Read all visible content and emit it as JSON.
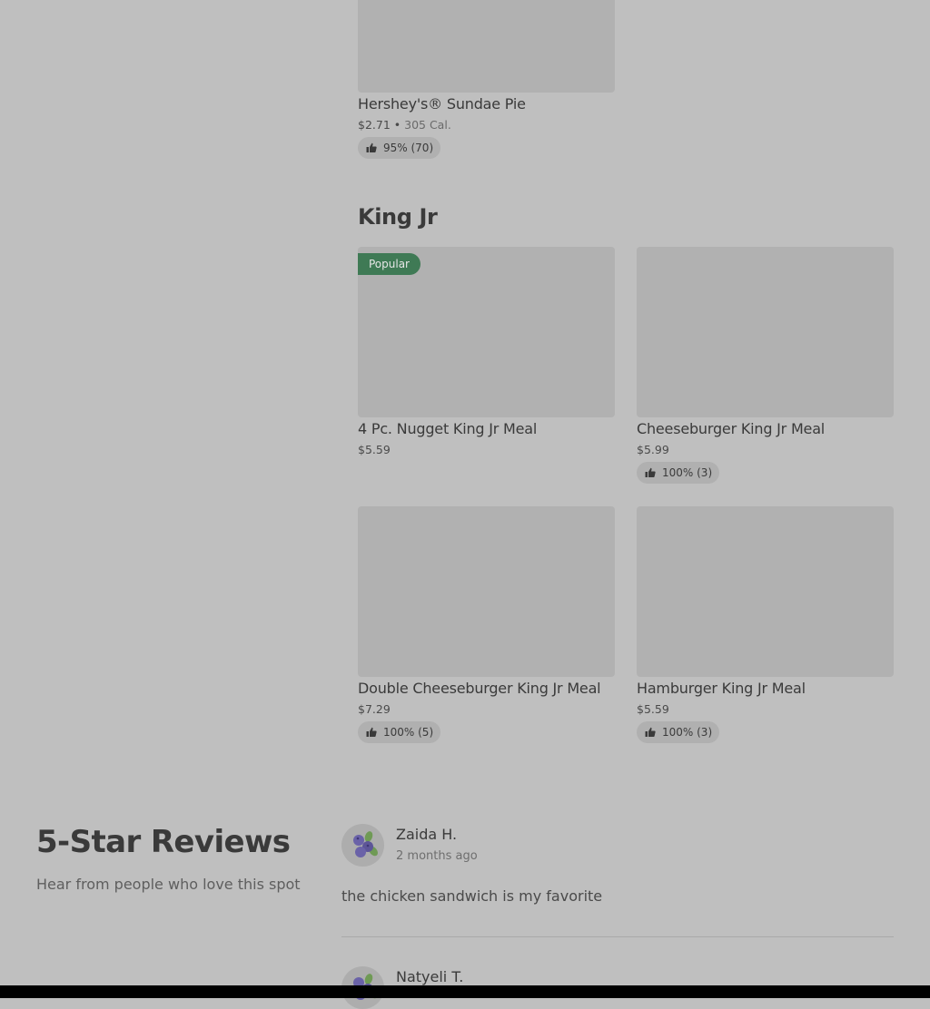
{
  "menu": {
    "dessert_item": {
      "name": "Hershey's® Sundae Pie",
      "price": "$2.71",
      "separator": " • ",
      "calories": "305 Cal.",
      "rating": "95% (70)"
    },
    "section_title": "King Jr",
    "items": [
      {
        "name": "4 Pc. Nugget King Jr Meal",
        "price": "$5.59",
        "badge": "Popular"
      },
      {
        "name": "Cheeseburger King Jr Meal",
        "price": "$5.99",
        "rating": "100% (3)"
      },
      {
        "name": "Double Cheeseburger King Jr Meal",
        "price": "$7.29",
        "rating": "100% (5)"
      },
      {
        "name": "Hamburger King Jr Meal",
        "price": "$5.59",
        "rating": "100% (3)"
      }
    ]
  },
  "reviews": {
    "title": "5-Star Reviews",
    "subtitle": "Hear from people who love this spot",
    "list": [
      {
        "name": "Zaida H.",
        "date": "2 months ago",
        "text": "the chicken sandwich is my favorite"
      },
      {
        "name": "Natyeli T."
      }
    ]
  },
  "icons": {
    "rating": "thumbs-up-icon",
    "avatar": "blueberry-avatar-icon"
  },
  "colors": {
    "background": "#bfbfbf",
    "image_placeholder": "#b1b1b1",
    "popular_badge": "#3f7a55"
  }
}
